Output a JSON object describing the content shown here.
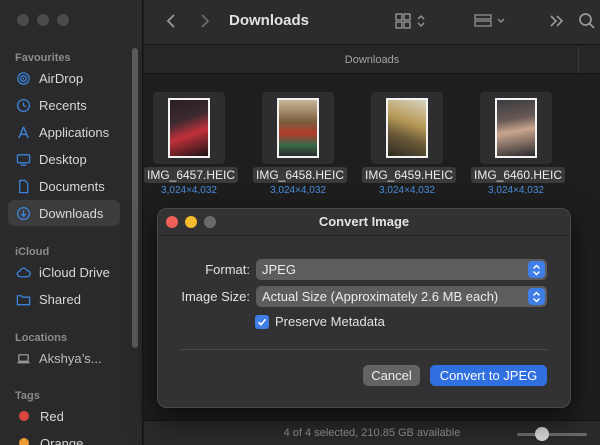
{
  "sidebar": {
    "sections": [
      {
        "label": "Favourites",
        "items": [
          {
            "label": "AirDrop",
            "icon": "airdrop-icon"
          },
          {
            "label": "Recents",
            "icon": "clock-icon"
          },
          {
            "label": "Applications",
            "icon": "applications-icon"
          },
          {
            "label": "Desktop",
            "icon": "desktop-icon"
          },
          {
            "label": "Documents",
            "icon": "document-icon"
          },
          {
            "label": "Downloads",
            "icon": "download-icon",
            "selected": true
          }
        ]
      },
      {
        "label": "iCloud",
        "items": [
          {
            "label": "iCloud Drive",
            "icon": "cloud-icon"
          },
          {
            "label": "Shared",
            "icon": "shared-folder-icon"
          }
        ]
      },
      {
        "label": "Locations",
        "items": [
          {
            "label": "Akshya’s...",
            "icon": "laptop-icon"
          }
        ]
      },
      {
        "label": "Tags",
        "items": [
          {
            "label": "Red",
            "icon": "tag-dot-icon",
            "color": "#e0443e"
          },
          {
            "label": "Orange",
            "icon": "tag-dot-icon",
            "color": "#f09a37"
          }
        ]
      }
    ]
  },
  "toolbar": {
    "title": "Downloads"
  },
  "pathbar": {
    "label": "Downloads"
  },
  "files": [
    {
      "name": "IMG_6457.HEIC",
      "dims": "3,024×4,032"
    },
    {
      "name": "IMG_6458.HEIC",
      "dims": "3,024×4,032"
    },
    {
      "name": "IMG_6459.HEIC",
      "dims": "3,024×4,032"
    },
    {
      "name": "IMG_6460.HEIC",
      "dims": "3,024×4,032"
    }
  ],
  "status": {
    "text": "4 of 4 selected, 210.85 GB available"
  },
  "dialog": {
    "title": "Convert Image",
    "format_label": "Format:",
    "format_value": "JPEG",
    "size_label": "Image Size:",
    "size_value": "Actual Size (Approximately 2.6 MB each)",
    "preserve_label": "Preserve Metadata",
    "preserve_checked": true,
    "cancel_label": "Cancel",
    "convert_label": "Convert to JPEG"
  },
  "colors": {
    "accent": "#3f7ee6",
    "primary_button": "#2f6fe0",
    "close": "#ed5f57",
    "minimize": "#f4bd30",
    "zoom_inactive": "#6a6a6c"
  }
}
